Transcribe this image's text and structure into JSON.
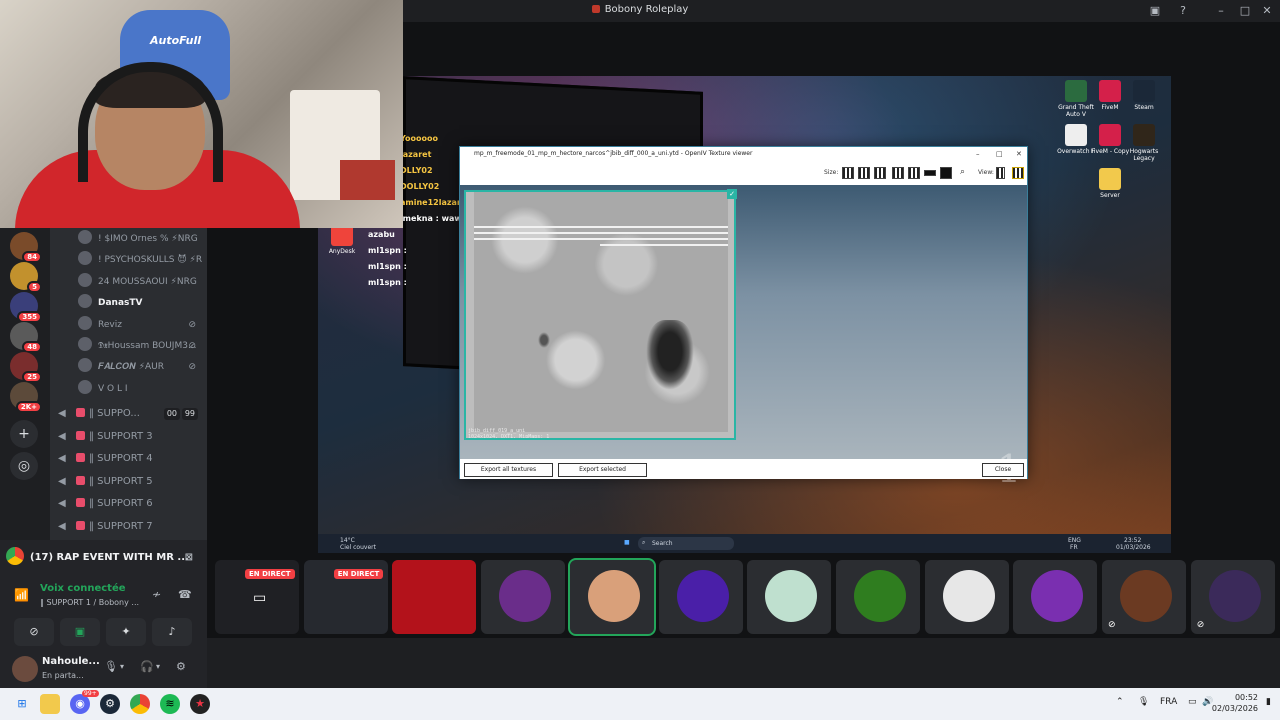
{
  "window": {
    "title": "Bobony Roleplay"
  },
  "webcam": {
    "chair_text": "AutoFull"
  },
  "servers": [
    {
      "badge": "84"
    },
    {
      "badge": "5"
    },
    {
      "badge": "355"
    },
    {
      "badge": "48"
    },
    {
      "badge": "25"
    },
    {
      "badge": "2K+"
    }
  ],
  "channels": {
    "voice_users": [
      {
        "name": "! $IMO Ornes % ⚡NRG",
        "bold": false
      },
      {
        "name": "! PSYCHOSKULLS 😈 ⚡R",
        "bold": false
      },
      {
        "name": "24 MOUSSAOUI ⚡NRG",
        "bold": false
      },
      {
        "name": "DanasTV",
        "bold": true
      },
      {
        "name": "Reviz",
        "bold": false
      },
      {
        "name": "𝕯𝖝Houssam BOUJM3...",
        "bold": false
      },
      {
        "name": "𝑭𝑨𝑳𝑪𝑶𝑵 ⚡AUR",
        "bold": false
      },
      {
        "name": "V O L I",
        "bold": false
      }
    ],
    "voice_channels": [
      {
        "name": "‖ SUPPO...",
        "count_a": "00",
        "count_b": "99"
      },
      {
        "name": "‖ SUPPORT 3"
      },
      {
        "name": "‖ SUPPORT 4"
      },
      {
        "name": "‖ SUPPORT 5"
      },
      {
        "name": "‖ SUPPORT 6"
      },
      {
        "name": "‖ SUPPORT 7"
      }
    ]
  },
  "panel": {
    "activity": "(17) RAP EVENT WITH MR ...",
    "voice_status": "Voix connectée",
    "voice_channel": "‖ SUPPORT 1 / Bobony ...",
    "username": "Nahoule...",
    "user_status": "En parta..."
  },
  "stream": {
    "chat": [
      {
        "text": "Yoooooo",
        "color": "#f5c542"
      },
      {
        "text": "lazaret",
        "color": "#f5c542"
      },
      {
        "text": "DLLY02",
        "color": "#f5c542"
      },
      {
        "text": "DOLLY02",
        "color": "#f5c542"
      },
      {
        "text": "amine12lazaret",
        "color": "#f5c542"
      },
      {
        "text": "Youssefmekna : waw",
        "color": "#ffffff"
      },
      {
        "text": "azabu",
        "color": "#ffffff"
      },
      {
        "text": "ml1spn :",
        "color": "#ffffff"
      },
      {
        "text": "ml1spn :",
        "color": "#ffffff"
      },
      {
        "text": "ml1spn :",
        "color": "#ffffff"
      }
    ],
    "desktop_icons": [
      {
        "label": "Grand Theft Auto V",
        "color": "#2b6b3f"
      },
      {
        "label": "FiveM",
        "color": "#d4204a"
      },
      {
        "label": "Steam",
        "color": "#1b2838"
      },
      {
        "label": "Overwatch F",
        "color": "#eeeeee"
      },
      {
        "label": "FiveM - Copy",
        "color": "#d4204a"
      },
      {
        "label": "Hogwarts Legacy",
        "color": "#30261a"
      },
      {
        "label": "Server",
        "color": "#f2c94c"
      }
    ],
    "inner_taskbar": {
      "weather": "14°C",
      "weather_desc": "Ciel couvert",
      "search": "Search",
      "lang": "ENG",
      "lang2": "FR",
      "time": "23:52",
      "date": "01/03/2026"
    },
    "anydesk_label": "AnyDesk"
  },
  "openiv": {
    "title": "mp_m_freemode_01_mp_m_hectore_narcos^jbib_diff_000_a_uni.ytd - OpenIV Texture viewer",
    "size_label": "Size:",
    "view_label": "View:",
    "texture_caption_1": "jbib_diff_019_a_uni",
    "texture_caption_2": "1024x1024, DXT1, MipMaps: 1",
    "page_number": "1",
    "export_all": "Export all textures",
    "export_selected": "Export selected",
    "close": "Close"
  },
  "participants": [
    {
      "live": "EN DIRECT",
      "color": "#1f2024"
    },
    {
      "live": "EN DIRECT",
      "color": "#26292f"
    },
    {
      "live": "",
      "color": "#b3121b"
    },
    {
      "live": "",
      "color": "#6a2d8a"
    },
    {
      "live": "",
      "color": "#d9a07a"
    },
    {
      "live": "",
      "color": "#4a1fa8"
    },
    {
      "live": "",
      "color": "#bfe0cf"
    },
    {
      "live": "",
      "color": "#2f7d1f"
    },
    {
      "live": "",
      "color": "#e7e7e7"
    },
    {
      "live": "",
      "color": "#7a2fb0"
    },
    {
      "live": "",
      "color": "#6b3a22"
    },
    {
      "live": "",
      "color": "#3b2a5a"
    }
  ],
  "taskbar": {
    "lang": "FRA",
    "time": "00:52",
    "date": "02/03/2026",
    "discord_badge": "99+"
  }
}
